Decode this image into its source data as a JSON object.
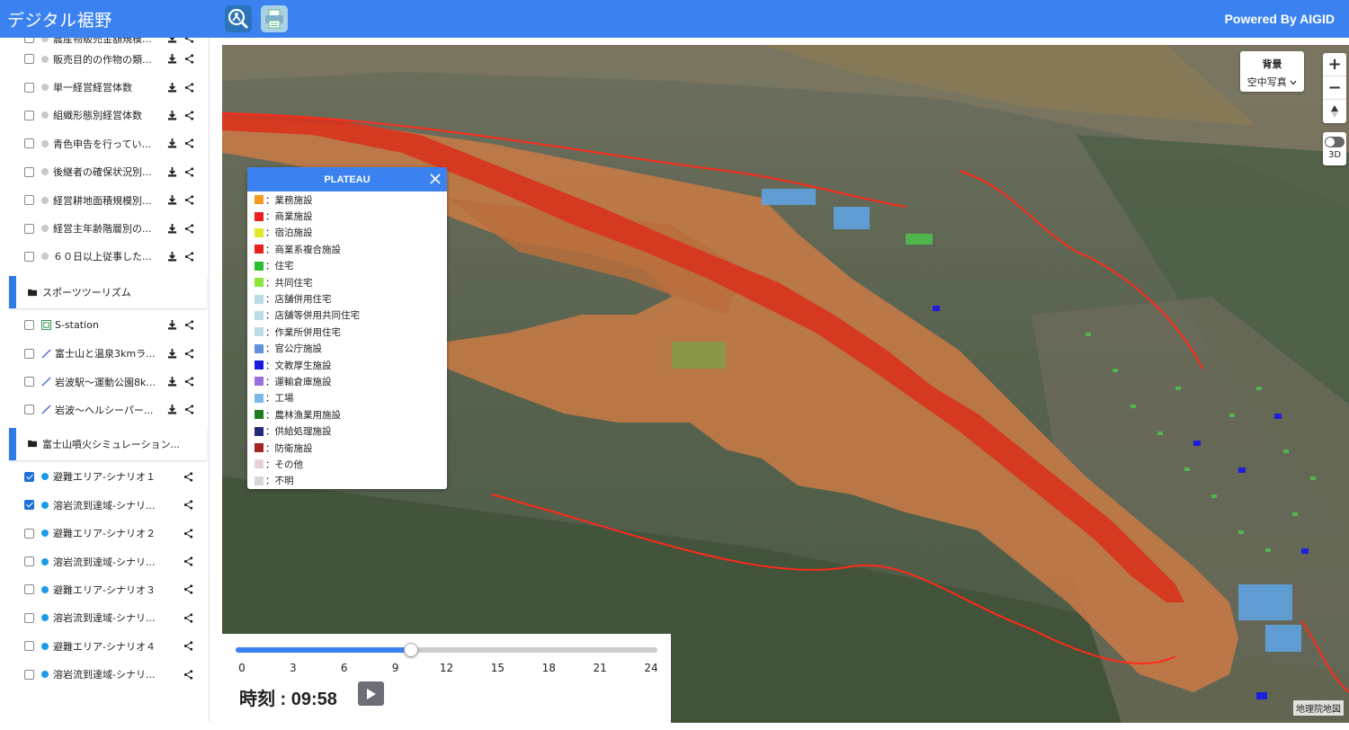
{
  "header": {
    "title": "デジタル裾野",
    "powered_by": "Powered By AIGID"
  },
  "sidebar": {
    "agri_items": [
      {
        "label": "農産物販売金額規模..."
      },
      {
        "label": "販売目的の作物の類..."
      },
      {
        "label": "単一経営経営体数"
      },
      {
        "label": "組織形態別経営体数"
      },
      {
        "label": "青色申告を行ってい..."
      },
      {
        "label": "後継者の確保状況別..."
      },
      {
        "label": "経営耕地面積規模別..."
      },
      {
        "label": "経営主年齢階層別の..."
      },
      {
        "label": "６０日以上従事した..."
      }
    ],
    "folder_sports": "スポーツツーリズム",
    "sports_items": [
      {
        "label": "S-station",
        "icon": "station-icon"
      },
      {
        "label": "富士山と温泉3kmラ...",
        "icon": "route-line-icon"
      },
      {
        "label": "岩波駅〜運動公園8k...",
        "icon": "route-line-icon"
      },
      {
        "label": "岩波〜ヘルシーパー...",
        "icon": "route-line-icon"
      }
    ],
    "folder_fuji": "富士山噴火シミュレーション...",
    "fuji_items": [
      {
        "label": "避難エリア-シナリオ１",
        "checked": true
      },
      {
        "label": "溶岩流到達域-シナリ...",
        "checked": true
      },
      {
        "label": "避難エリア-シナリオ２",
        "checked": false
      },
      {
        "label": "溶岩流到達域-シナリ...",
        "checked": false
      },
      {
        "label": "避難エリア-シナリオ３",
        "checked": false
      },
      {
        "label": "溶岩流到達域-シナリ...",
        "checked": false
      },
      {
        "label": "避難エリア-シナリオ４",
        "checked": false
      },
      {
        "label": "溶岩流到達域-シナリ...",
        "checked": false
      }
    ]
  },
  "map": {
    "background_title": "背景",
    "background_value": "空中写真",
    "zoom_in": "+",
    "zoom_out": "−",
    "toggle_3d_label": "3D",
    "attribution": "地理院地図"
  },
  "legend": {
    "title": "PLATEAU",
    "items": [
      {
        "label": "：業務施設",
        "color": "#f59a1e"
      },
      {
        "label": "：商業施設",
        "color": "#e8201e"
      },
      {
        "label": "：宿泊施設",
        "color": "#e6e62a"
      },
      {
        "label": "：商業系複合施設",
        "color": "#e8201e"
      },
      {
        "label": "：住宅",
        "color": "#2bbd2b"
      },
      {
        "label": "：共同住宅",
        "color": "#8be63a"
      },
      {
        "label": "：店舗併用住宅",
        "color": "#b8dde6"
      },
      {
        "label": "：店舗等併用共同住宅",
        "color": "#b8dde6"
      },
      {
        "label": "：作業所併用住宅",
        "color": "#b8dde6"
      },
      {
        "label": "：官公庁施設",
        "color": "#5f92d8"
      },
      {
        "label": "：文教厚生施設",
        "color": "#1a1ae0"
      },
      {
        "label": "：運輸倉庫施設",
        "color": "#9b6ee0"
      },
      {
        "label": "：工場",
        "color": "#7ab8ea"
      },
      {
        "label": "：農林漁業用施設",
        "color": "#1e7a1e"
      },
      {
        "label": "：供給処理施設",
        "color": "#25287a"
      },
      {
        "label": "：防衛施設",
        "color": "#a0251e"
      },
      {
        "label": "：その他",
        "color": "#e8d0d8"
      },
      {
        "label": "：不明",
        "color": "#d8d8d8"
      }
    ]
  },
  "timeline": {
    "ticks": [
      "0",
      "3",
      "6",
      "9",
      "12",
      "15",
      "18",
      "21",
      "24"
    ],
    "min": 0,
    "max": 24,
    "current_hours": 9.97,
    "time_label": "時刻 : 09:58"
  }
}
